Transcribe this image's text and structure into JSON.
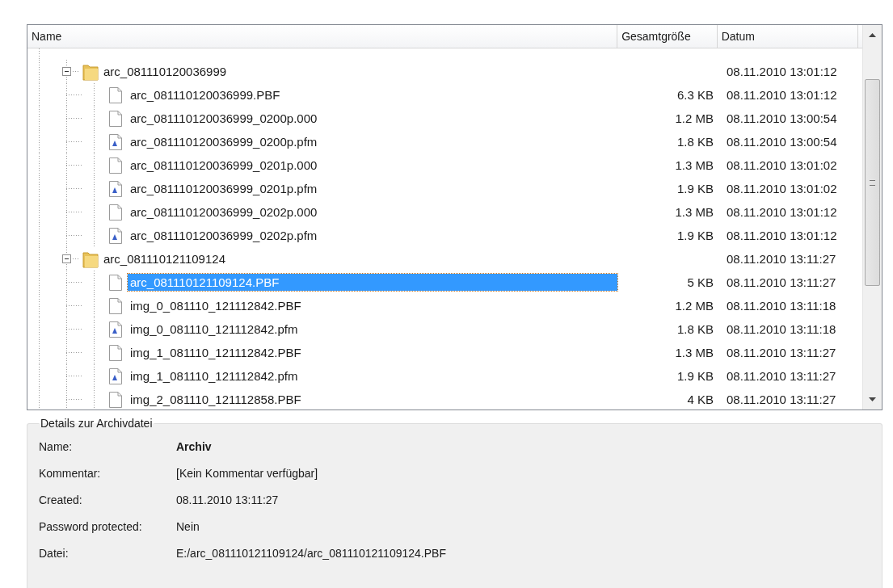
{
  "columns": [
    "Name",
    "Gesamtgröße",
    "Datum"
  ],
  "tree": [
    {
      "kind": "folder",
      "name": "arc_081110120036999",
      "date": "08.11.2010 13:01:12",
      "expanded": true,
      "selected": false,
      "children": [
        {
          "kind": "file",
          "name": "arc_081110120036999.PBF",
          "size": "6.3 KB",
          "date": "08.11.2010 13:01:12",
          "selected": false
        },
        {
          "kind": "file",
          "name": "arc_081110120036999_0200p.000",
          "size": "1.2 MB",
          "date": "08.11.2010 13:00:54",
          "selected": false
        },
        {
          "kind": "font-file",
          "name": "arc_081110120036999_0200p.pfm",
          "size": "1.8 KB",
          "date": "08.11.2010 13:00:54",
          "selected": false
        },
        {
          "kind": "file",
          "name": "arc_081110120036999_0201p.000",
          "size": "1.3 MB",
          "date": "08.11.2010 13:01:02",
          "selected": false
        },
        {
          "kind": "font-file",
          "name": "arc_081110120036999_0201p.pfm",
          "size": "1.9 KB",
          "date": "08.11.2010 13:01:02",
          "selected": false
        },
        {
          "kind": "file",
          "name": "arc_081110120036999_0202p.000",
          "size": "1.3 MB",
          "date": "08.11.2010 13:01:12",
          "selected": false
        },
        {
          "kind": "font-file",
          "name": "arc_081110120036999_0202p.pfm",
          "size": "1.9 KB",
          "date": "08.11.2010 13:01:12",
          "selected": false
        }
      ]
    },
    {
      "kind": "folder",
      "name": "arc_081110121109124",
      "date": "08.11.2010 13:11:27",
      "expanded": true,
      "selected": false,
      "children": [
        {
          "kind": "file",
          "name": "arc_081110121109124.PBF",
          "size": "5 KB",
          "date": "08.11.2010 13:11:27",
          "selected": true
        },
        {
          "kind": "file",
          "name": "img_0_081110_121112842.PBF",
          "size": "1.2 MB",
          "date": "08.11.2010 13:11:18",
          "selected": false
        },
        {
          "kind": "font-file",
          "name": "img_0_081110_121112842.pfm",
          "size": "1.8 KB",
          "date": "08.11.2010 13:11:18",
          "selected": false
        },
        {
          "kind": "file",
          "name": "img_1_081110_121112842.PBF",
          "size": "1.3 MB",
          "date": "08.11.2010 13:11:27",
          "selected": false
        },
        {
          "kind": "font-file",
          "name": "img_1_081110_121112842.pfm",
          "size": "1.9 KB",
          "date": "08.11.2010 13:11:27",
          "selected": false
        },
        {
          "kind": "file",
          "name": "img_2_081110_121112858.PBF",
          "size": "4 KB",
          "date": "08.11.2010 13:11:27",
          "selected": false
        }
      ]
    }
  ],
  "details": {
    "title": "Details zur Archivdatei",
    "rows": [
      {
        "label": "Name:",
        "value": "Archiv",
        "bold": true
      },
      {
        "label": "Kommentar:",
        "value": "[Kein Kommentar verfügbar]",
        "bold": false
      },
      {
        "label": "Created:",
        "value": "08.11.2010 13:11:27",
        "bold": false
      },
      {
        "label": "Password protected:",
        "value": "Nein",
        "bold": false
      },
      {
        "label": "Datei:",
        "value": "E:/arc_081110121109124/arc_081110121109124.PBF",
        "bold": false
      }
    ]
  }
}
